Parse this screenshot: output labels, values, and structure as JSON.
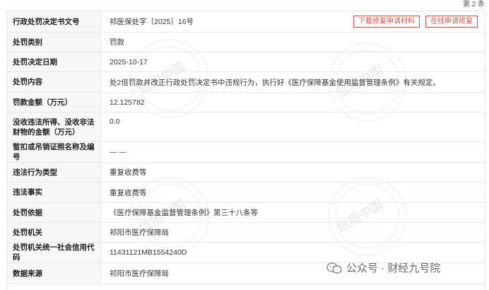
{
  "counter": "第 2 条",
  "buttons": {
    "download": "下载修复申请材料",
    "apply": "在线申请修复"
  },
  "rows": [
    {
      "label": "行政处罚决定书文号",
      "value": "祁医保处字〔2025〕16号"
    },
    {
      "label": "处罚类别",
      "value": "罚款"
    },
    {
      "label": "处罚决定日期",
      "value": "2025-10-17"
    },
    {
      "label": "处罚内容",
      "value": "处2倍罚款并改正行政处罚决定书中违规行为，执行好《医疗保障基金使用监督管理条例》有关规定。"
    },
    {
      "label": "罚款金额（万元）",
      "value": "12.125782"
    },
    {
      "label": "没收违法所得、没收非法财物的金额（万元）",
      "value": "0.0"
    },
    {
      "label": "暂扣或吊销证照名称及编号",
      "value": "— —"
    },
    {
      "label": "违法行为类型",
      "value": "重复收费等"
    },
    {
      "label": "违法事实",
      "value": "重复收费等"
    },
    {
      "label": "处罚依据",
      "value": "《医疗保障基金监督管理条例》第三十八条等"
    },
    {
      "label": "处罚机关",
      "value": "祁阳市医疗保障局"
    },
    {
      "label": "处罚机关统一社会信用代码",
      "value": "11431121MB1554240D"
    },
    {
      "label": "数据来源",
      "value": "祁阳市医疗保障局"
    }
  ],
  "watermark_text": "信用中国",
  "wechat": {
    "text": "公众号 · 财经九号院",
    "icon": "wechat-icon"
  }
}
